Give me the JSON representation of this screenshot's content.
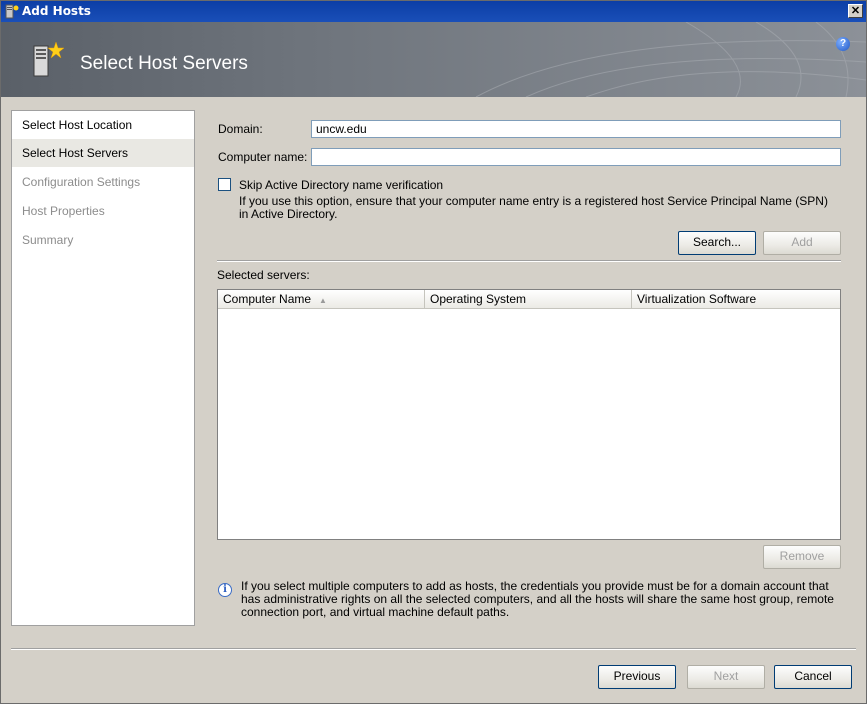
{
  "window": {
    "title": "Add Hosts",
    "close_glyph": "✕"
  },
  "header": {
    "title": "Select Host Servers",
    "help_glyph": "?"
  },
  "nav": {
    "items": [
      {
        "label": "Select Host Location",
        "state": "normal"
      },
      {
        "label": "Select Host Servers",
        "state": "selected"
      },
      {
        "label": "Configuration Settings",
        "state": "disabled"
      },
      {
        "label": "Host Properties",
        "state": "disabled"
      },
      {
        "label": "Summary",
        "state": "disabled"
      }
    ]
  },
  "form": {
    "domain_label": "Domain:",
    "domain_value": "uncw.edu",
    "computer_name_label": "Computer name:",
    "computer_name_value": "",
    "skip_ad_label": "Skip Active Directory name verification",
    "skip_ad_checked": false,
    "skip_ad_note": "If you use this option, ensure that your computer name entry is a registered host Service Principal Name (SPN) in Active Directory.",
    "search_button": "Search...",
    "add_button": "Add"
  },
  "selected_servers": {
    "label": "Selected servers:",
    "columns": [
      "Computer Name",
      "Operating System",
      "Virtualization Software"
    ],
    "sort_glyph": "▲",
    "rows": [],
    "remove_button": "Remove"
  },
  "info": {
    "icon": "info-icon",
    "text": "If you select multiple computers to add as hosts, the credentials you provide must be for a domain account that has administrative rights on all the selected computers, and all the hosts will share the same host group, remote connection port, and virtual machine default paths."
  },
  "footer": {
    "previous_button": "Previous",
    "next_button": "Next",
    "cancel_button": "Cancel"
  },
  "colors": {
    "titlebar": "#0c3ea6",
    "header_band": "#6e747c",
    "selected_nav": "#e9e8e3",
    "disabled_text": "#8c8c8c"
  }
}
